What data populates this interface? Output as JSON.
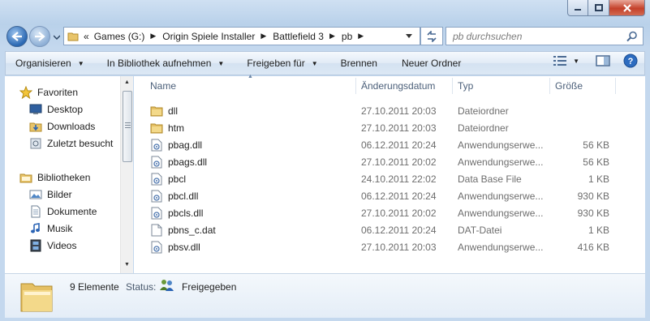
{
  "window": {
    "caption_buttons": [
      "minimize-icon",
      "maximize-icon",
      "close-icon"
    ]
  },
  "address_bar": {
    "overflow_marker": "«",
    "crumbs": [
      "Games (G:)",
      "Origin Spiele Installer",
      "Battlefield 3",
      "pb"
    ]
  },
  "search": {
    "placeholder": "pb durchsuchen"
  },
  "toolbar": {
    "organize": "Organisieren",
    "library": "In Bibliothek aufnehmen",
    "share": "Freigeben für",
    "burn": "Brennen",
    "new_folder": "Neuer Ordner"
  },
  "nav": {
    "favorites": "Favoriten",
    "desktop": "Desktop",
    "downloads": "Downloads",
    "recent": "Zuletzt besucht",
    "libraries": "Bibliotheken",
    "pictures": "Bilder",
    "documents": "Dokumente",
    "music": "Musik",
    "videos": "Videos"
  },
  "columns": {
    "name": "Name",
    "date": "Änderungsdatum",
    "type": "Typ",
    "size": "Größe"
  },
  "files": [
    {
      "name": "dll",
      "date": "27.10.2011 20:03",
      "type": "Dateiordner",
      "size": "",
      "icon": "folder-icon"
    },
    {
      "name": "htm",
      "date": "27.10.2011 20:03",
      "type": "Dateiordner",
      "size": "",
      "icon": "folder-icon"
    },
    {
      "name": "pbag.dll",
      "date": "06.12.2011 20:24",
      "type": "Anwendungserwe...",
      "size": "56 KB",
      "icon": "dll-file-icon"
    },
    {
      "name": "pbags.dll",
      "date": "27.10.2011 20:02",
      "type": "Anwendungserwe...",
      "size": "56 KB",
      "icon": "dll-file-icon"
    },
    {
      "name": "pbcl",
      "date": "24.10.2011 22:02",
      "type": "Data Base File",
      "size": "1 KB",
      "icon": "db-file-icon"
    },
    {
      "name": "pbcl.dll",
      "date": "06.12.2011 20:24",
      "type": "Anwendungserwe...",
      "size": "930 KB",
      "icon": "dll-file-icon"
    },
    {
      "name": "pbcls.dll",
      "date": "27.10.2011 20:02",
      "type": "Anwendungserwe...",
      "size": "930 KB",
      "icon": "dll-file-icon"
    },
    {
      "name": "pbns_c.dat",
      "date": "06.12.2011 20:24",
      "type": "DAT-Datei",
      "size": "1 KB",
      "icon": "blank-file-icon"
    },
    {
      "name": "pbsv.dll",
      "date": "27.10.2011 20:03",
      "type": "Anwendungserwe...",
      "size": "416 KB",
      "icon": "dll-file-icon"
    }
  ],
  "details": {
    "count": "9 Elemente",
    "status_label": "Status:",
    "status_value": "Freigegeben"
  }
}
